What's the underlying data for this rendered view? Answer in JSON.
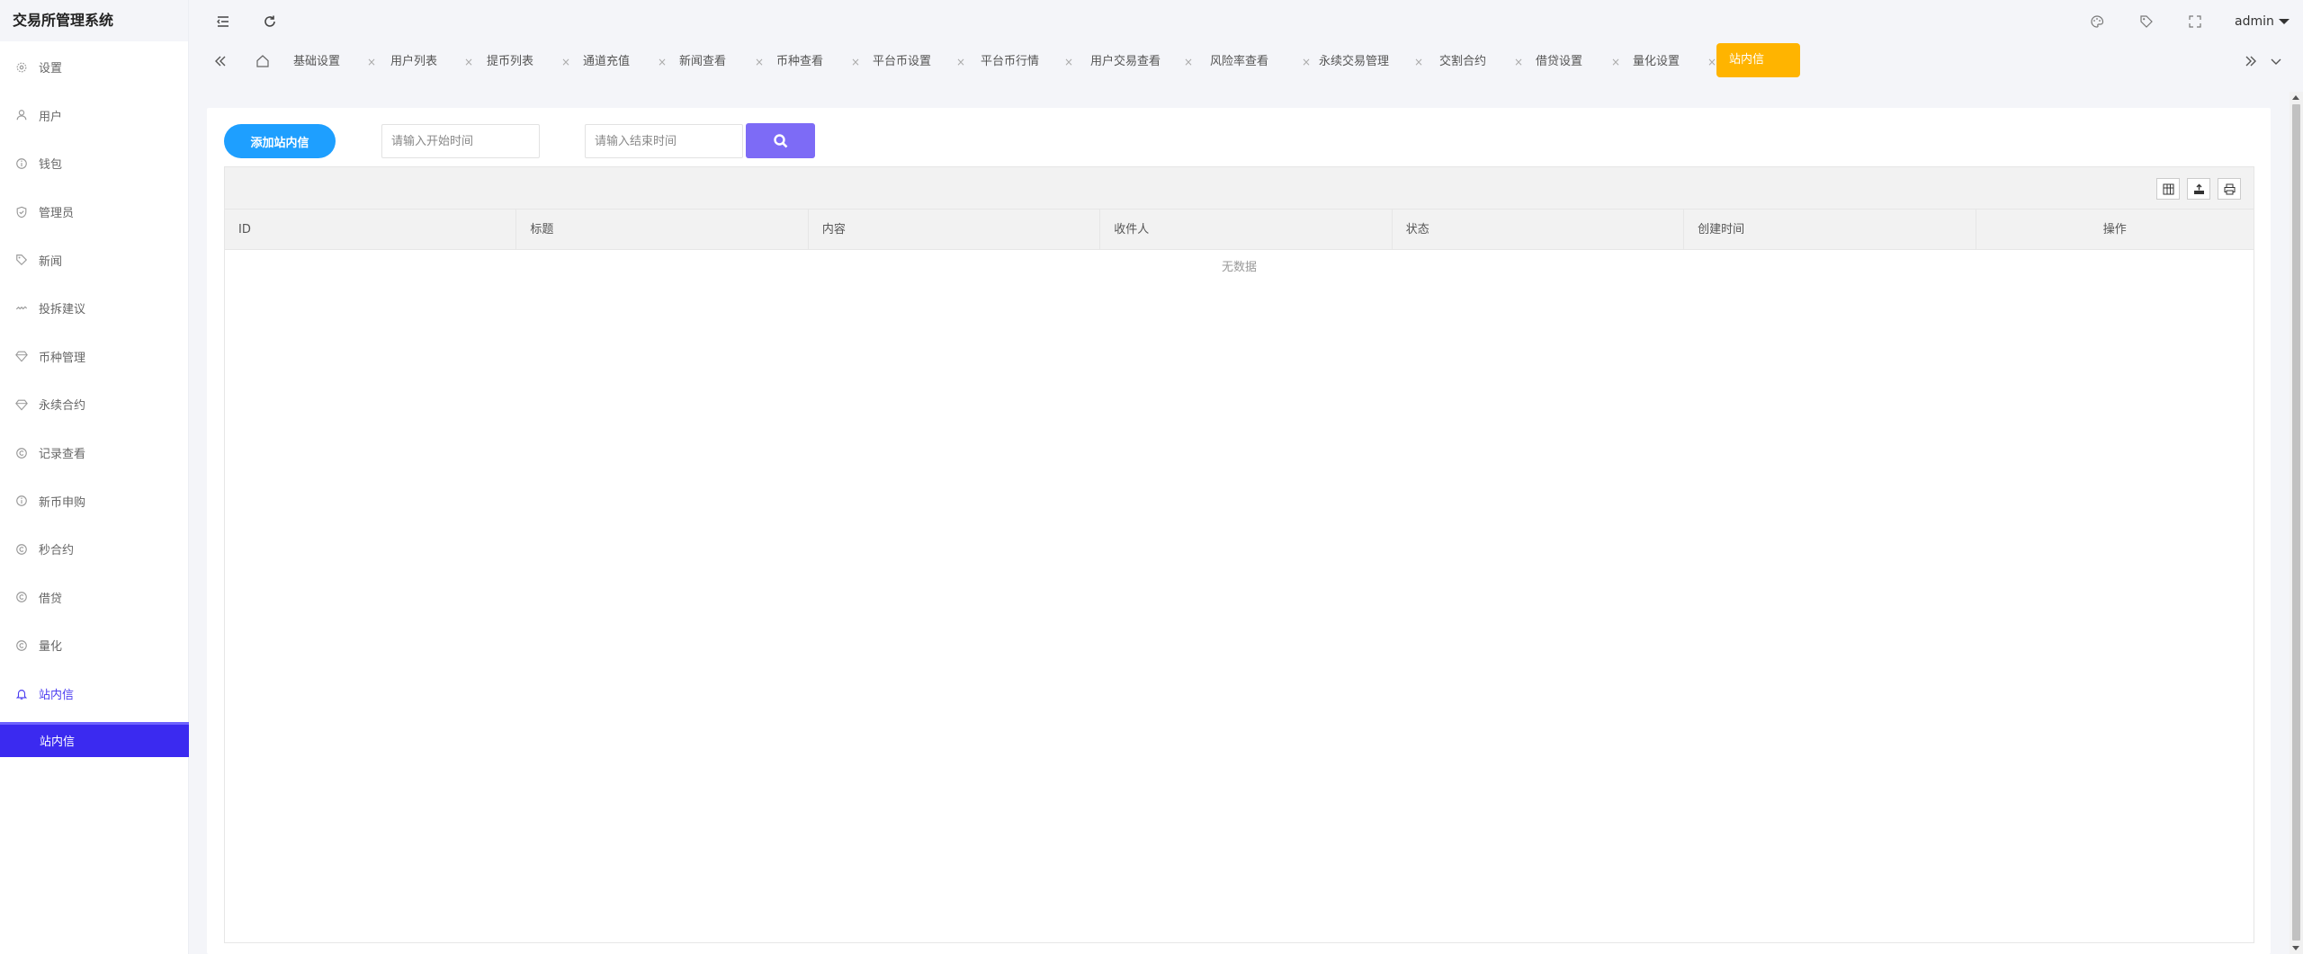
{
  "app": {
    "title": "交易所管理系统"
  },
  "sidebar": {
    "items": [
      {
        "label": "设置",
        "icon": "gear-icon"
      },
      {
        "label": "用户",
        "icon": "user-icon"
      },
      {
        "label": "钱包",
        "icon": "info-circle-icon"
      },
      {
        "label": "管理员",
        "icon": "shield-check-icon"
      },
      {
        "label": "新闻",
        "icon": "tag-icon"
      },
      {
        "label": "投拆建议",
        "icon": "link-icon"
      },
      {
        "label": "币种管理",
        "icon": "diamond-icon"
      },
      {
        "label": "永续合约",
        "icon": "diamond-icon"
      },
      {
        "label": "记录查看",
        "icon": "copyright-icon"
      },
      {
        "label": "新币申购",
        "icon": "info-circle-icon"
      },
      {
        "label": "秒合约",
        "icon": "copyright-icon"
      },
      {
        "label": "借贷",
        "icon": "copyright-icon"
      },
      {
        "label": "量化",
        "icon": "copyright-icon"
      },
      {
        "label": "站内信",
        "icon": "bell-icon"
      }
    ],
    "active_sub": "站内信"
  },
  "header": {
    "user": "admin"
  },
  "tabs": [
    {
      "label": "基础设置"
    },
    {
      "label": "用户列表"
    },
    {
      "label": "提币列表"
    },
    {
      "label": "通道充值"
    },
    {
      "label": "新闻查看"
    },
    {
      "label": "币种查看"
    },
    {
      "label": "平台币设置"
    },
    {
      "label": "平台币行情"
    },
    {
      "label": "用户交易查看"
    },
    {
      "label": "风险率查看"
    },
    {
      "label": "永续交易管理"
    },
    {
      "label": "交割合约"
    },
    {
      "label": "借贷设置"
    },
    {
      "label": "量化设置"
    },
    {
      "label": "站内信"
    }
  ],
  "tab_close": "×",
  "toolbar": {
    "add_label": "添加站内信",
    "start_placeholder": "请输入开始时间",
    "end_placeholder": "请输入结束时间"
  },
  "table": {
    "columns": [
      "ID",
      "标题",
      "内容",
      "收件人",
      "状态",
      "创建时间",
      "操作"
    ],
    "empty_text": "无数据"
  },
  "colors": {
    "accent": "#3b2af0",
    "active_tab": "#ffb400",
    "add_button": "#1e9fff",
    "search_button": "#7d6bf6"
  }
}
